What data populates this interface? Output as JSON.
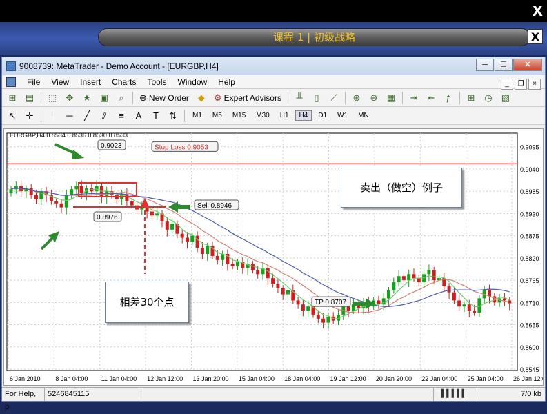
{
  "banner": {
    "title": "课程 1 | 初级战略",
    "close_label": "X"
  },
  "top_close_label": "X",
  "window": {
    "title": "9008739: MetaTrader - Demo Account - [EURGBP,H4]",
    "min_label": "─",
    "max_label": "☐",
    "close_label": "✕"
  },
  "menu": [
    "File",
    "View",
    "Insert",
    "Charts",
    "Tools",
    "Window",
    "Help"
  ],
  "toolbar": {
    "new_order_label": "New Order",
    "expert_advisors_label": "Expert Advisors"
  },
  "timeframes": [
    "M1",
    "M5",
    "M15",
    "M30",
    "H1",
    "H4",
    "D1",
    "W1",
    "MN"
  ],
  "active_timeframe": "H4",
  "status": {
    "help": "For Help, p",
    "code": "5246845115",
    "kb": "7/0 kb"
  },
  "notes": {
    "sell_example": "卖出（做空）例子",
    "difference": "相差30个点"
  },
  "chart_data": {
    "type": "candlestick",
    "symbol_header": "EURGBP,H4  0.8534 0.8536 0.8530 0.8533",
    "ylim": [
      0.8545,
      0.9115
    ],
    "y_ticks": [
      "0.9095",
      "0.9040",
      "0.8985",
      "0.8930",
      "0.8875",
      "0.8820",
      "0.8765",
      "0.8710",
      "0.8655",
      "0.8600",
      "0.8545"
    ],
    "x_ticks": [
      "6 Jan 2010",
      "8 Jan 04:00",
      "11 Jan 04:00",
      "12 Jan 12:00",
      "13 Jan 20:00",
      "15 Jan 04:00",
      "18 Jan 04:00",
      "19 Jan 12:00",
      "20 Jan 20:00",
      "22 Jan 04:00",
      "25 Jan 04:00",
      "26 Jan 12:00"
    ],
    "stop_loss": {
      "label": "Stop Loss 0.9053",
      "value": 0.9053
    },
    "sell": {
      "label": "Sell 0.8946",
      "value": 0.8946
    },
    "tp": {
      "label": "TP 0.8707",
      "value": 0.8707
    },
    "high_label": "0.9023",
    "low_label": "0.8976",
    "colors": {
      "up": "#1aa01a",
      "down": "#cc2020",
      "stop": "#e03030",
      "ma_fast": "#6acc6a",
      "ma_mid": "#d08070",
      "ma_slow": "#4a5bb0",
      "arrow": "#2e8a2e"
    },
    "closes": [
      0.899,
      0.8998,
      0.8985,
      0.8992,
      0.8975,
      0.8965,
      0.8985,
      0.8975,
      0.896,
      0.8955,
      0.8945,
      0.8975,
      0.899,
      0.8998,
      0.898,
      0.8992,
      0.8985,
      0.8998,
      0.897,
      0.8985,
      0.8975,
      0.8965,
      0.8978,
      0.896,
      0.895,
      0.894,
      0.8945,
      0.8935,
      0.8925,
      0.893,
      0.891,
      0.889,
      0.8905,
      0.888,
      0.887,
      0.886,
      0.8875,
      0.8845,
      0.883,
      0.885,
      0.8825,
      0.8815,
      0.883,
      0.8805,
      0.88,
      0.881,
      0.8795,
      0.8805,
      0.879,
      0.878,
      0.8795,
      0.877,
      0.8755,
      0.8745,
      0.873,
      0.874,
      0.8715,
      0.8705,
      0.869,
      0.87,
      0.868,
      0.867,
      0.866,
      0.8675,
      0.8665,
      0.868,
      0.87,
      0.869,
      0.8705,
      0.8695,
      0.871,
      0.87,
      0.8715,
      0.8705,
      0.872,
      0.874,
      0.876,
      0.8775,
      0.8765,
      0.878,
      0.877,
      0.876,
      0.878,
      0.879,
      0.8765,
      0.877,
      0.875,
      0.8735,
      0.8715,
      0.87,
      0.8705,
      0.869,
      0.8685,
      0.872,
      0.874,
      0.8725,
      0.871,
      0.872,
      0.8715,
      0.8708
    ]
  }
}
